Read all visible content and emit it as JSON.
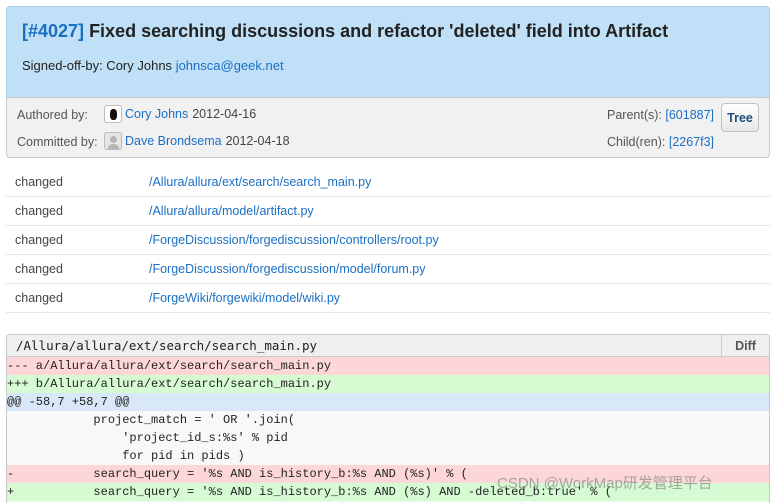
{
  "commit": {
    "number": "[#4027]",
    "title": "Fixed searching discussions and refactor 'deleted' field into Artifact",
    "signed_off_prefix": "Signed-off-by: Cory Johns",
    "signed_off_email": "johnsca@geek.net"
  },
  "meta": {
    "authored_label": "Authored by:",
    "author_name": "Cory Johns",
    "author_date": "2012-04-16",
    "committed_label": "Committed by:",
    "committer_name": "Dave Brondsema",
    "committer_date": "2012-04-18",
    "parents_label": "Parent(s):",
    "parent_hash": "[601887]",
    "children_label": "Child(ren):",
    "child_hash": "[2267f3]",
    "tree_button": "Tree",
    "author_avatar_icon": "user-avatar-icon",
    "committer_avatar_icon": "default-avatar-icon"
  },
  "changes": [
    {
      "kind": "changed",
      "path": "/Allura/allura/ext/search/search_main.py"
    },
    {
      "kind": "changed",
      "path": "/Allura/allura/model/artifact.py"
    },
    {
      "kind": "changed",
      "path": "/ForgeDiscussion/forgediscussion/controllers/root.py"
    },
    {
      "kind": "changed",
      "path": "/ForgeDiscussion/forgediscussion/model/forum.py"
    },
    {
      "kind": "changed",
      "path": "/ForgeWiki/forgewiki/model/wiki.py"
    }
  ],
  "diff": {
    "file": "/Allura/allura/ext/search/search_main.py",
    "diff_button": "Diff",
    "lines": [
      {
        "type": "del",
        "text": "--- a/Allura/allura/ext/search/search_main.py"
      },
      {
        "type": "add",
        "text": "+++ b/Allura/allura/ext/search/search_main.py"
      },
      {
        "type": "hunk",
        "text": "@@ -58,7 +58,7 @@"
      },
      {
        "type": "ctx",
        "text": "            project_match = ' OR '.join("
      },
      {
        "type": "ctx",
        "text": "                'project_id_s:%s' % pid"
      },
      {
        "type": "ctx",
        "text": "                for pid in pids )"
      },
      {
        "type": "del",
        "text": "-           search_query = '%s AND is_history_b:%s AND (%s)' % ("
      },
      {
        "type": "add",
        "text": "+           search_query = '%s AND is_history_b:%s AND (%s) AND -deleted_b:true' % ("
      }
    ]
  },
  "watermark": "CSDN @WorkMap研发管理平台"
}
